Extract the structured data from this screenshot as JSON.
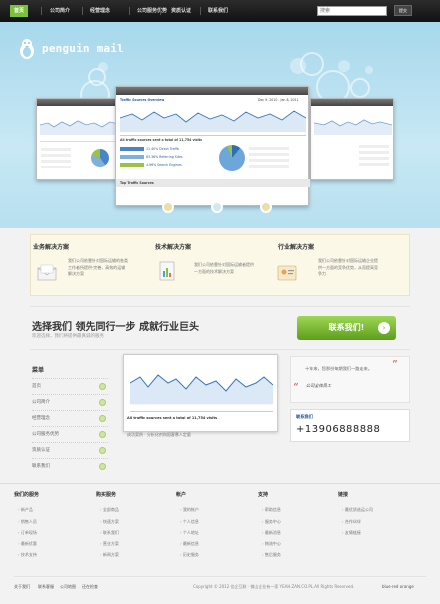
{
  "nav": {
    "items": [
      "首页",
      "公司简介",
      "经营理念",
      "公司服务优势",
      "资质认证",
      "联系我们"
    ],
    "active_index": 0,
    "search_placeholder": "搜索",
    "search_button": "提交"
  },
  "hero": {
    "logo_text": "penguin mail",
    "screenshot": {
      "title": "Traffic Sources Overview",
      "date_range": "Dec 9, 2010 - Jan 8, 2011",
      "summary": "All traffic sources sent a total of 11,754 visits",
      "stats": [
        "11.40% Direct Traffic",
        "83.36% Referring Sites",
        "4.96% Search Engines"
      ],
      "section": "Top Traffic Sources"
    },
    "slides": 3,
    "active_slide": 1
  },
  "solutions": [
    {
      "title": "业务解决方案",
      "text": "我们公司依靠针对国际运输的各类工作者所提供·完善，高效的运输解决方案"
    },
    {
      "title": "技术解决方案",
      "text": "我们公司依靠针对国际运输者提供一方面的技术解决方案"
    },
    {
      "title": "行业解决方案",
      "text": "我们公司依靠针对国际运输企业提供一方面的竞争优势，从而提高竞争力"
    }
  ],
  "slogan": {
    "title": "选择我们  领先同行一步  成就行业巨头",
    "subtitle": "欢迎选择，我们将提供最真诚的服务",
    "button": "联系我们!"
  },
  "menu": {
    "title": "菜单",
    "items": [
      "首页",
      "公司简介",
      "经营理念",
      "公司服务优势",
      "资质认证",
      "联系我们"
    ]
  },
  "chart_panel": {
    "caption": "All traffic sources sent a total of 11,754 visits",
    "desc": "成功案例 · 分析化剂和国客慕人定量"
  },
  "testimonial": {
    "text": "十年来，您那份每期我们一路走来。",
    "author": "公司全体员工"
  },
  "contact": {
    "label": "联系我们",
    "phone": "+13906888888"
  },
  "footer": {
    "columns": [
      {
        "title": "我们的服务",
        "links": [
          "新产品",
          "销售人员",
          "订单现场",
          "最新优惠",
          "技术支持"
        ]
      },
      {
        "title": "购买服务",
        "links": [
          "全部商品",
          "快速方案",
          "联系我们",
          "营业方案",
          "新闻方案"
        ]
      },
      {
        "title": "帐户",
        "links": [
          "我的帐户",
          "个人信息",
          "个人地址",
          "最新信息",
          "历史服务"
        ]
      },
      {
        "title": "支持",
        "links": [
          "帮助信息",
          "服务中心",
          "最新消息",
          "物流中心",
          "售后服务"
        ]
      },
      {
        "title": "链接",
        "links": [
          "最优质选运公司",
          "合作伙伴",
          "友情链接"
        ]
      }
    ],
    "bottom_links": [
      "关于我们",
      "联系客服",
      "公司地图",
      "还在检查"
    ],
    "copyright": "Copyright © 2012 佳企互联 · 佛山企业有一家 YEAH.ZAN.CO.PL.All Rights Reserved.",
    "theme": "blue·red orange"
  }
}
